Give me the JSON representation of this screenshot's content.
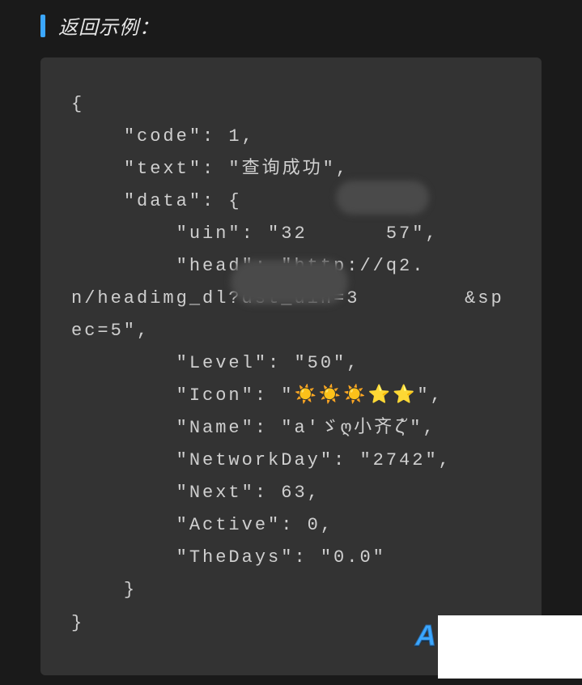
{
  "heading": "返回示例：",
  "code_lines": [
    "{",
    "    \"code\": 1,",
    "    \"text\": \"查询成功\",",
    "    \"data\": {",
    "        \"uin\": \"32      57\",",
    "        \"head\": \"http://q2.     n/headimg_dl?dst_uin=3        &spec=5\",",
    "        \"Level\": \"50\",",
    "        \"Icon\": \"☀️☀️☀️⭐⭐\",",
    "        \"Name\": \"a'ゞღ小齐ζั\",",
    "        \"NetworkDay\": \"2742\",",
    "        \"Next\": 63,",
    "        \"Active\": 0,",
    "        \"TheDays\": \"0.0\"",
    "    }",
    "}"
  ],
  "watermark_letter": "A"
}
